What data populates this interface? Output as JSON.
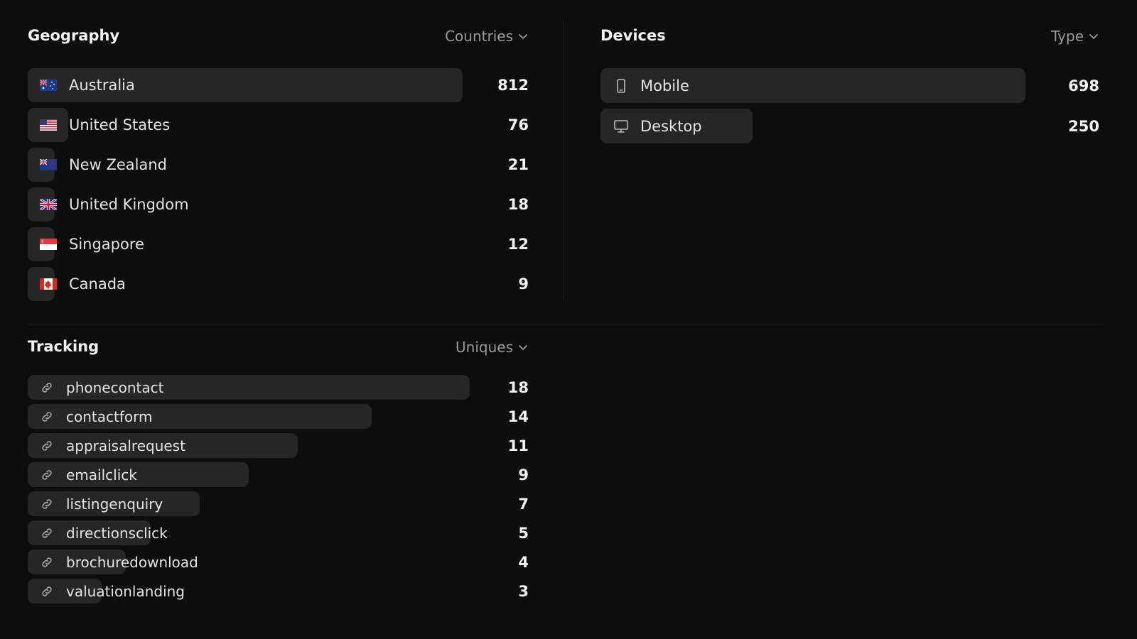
{
  "geography": {
    "title": "Geography",
    "dropdown_label": "Countries",
    "max_value": 812,
    "rows": [
      {
        "label": "Australia",
        "value": "812",
        "n": 812,
        "flag": "au"
      },
      {
        "label": "United States",
        "value": "76",
        "n": 76,
        "flag": "us"
      },
      {
        "label": "New Zealand",
        "value": "21",
        "n": 21,
        "flag": "nz"
      },
      {
        "label": "United Kingdom",
        "value": "18",
        "n": 18,
        "flag": "gb"
      },
      {
        "label": "Singapore",
        "value": "12",
        "n": 12,
        "flag": "sg"
      },
      {
        "label": "Canada",
        "value": "9",
        "n": 9,
        "flag": "ca"
      }
    ]
  },
  "devices": {
    "title": "Devices",
    "dropdown_label": "Type",
    "max_value": 698,
    "rows": [
      {
        "label": "Mobile",
        "value": "698",
        "n": 698,
        "icon": "mobile-icon"
      },
      {
        "label": "Desktop",
        "value": "250",
        "n": 250,
        "icon": "desktop-icon"
      }
    ]
  },
  "tracking": {
    "title": "Tracking",
    "dropdown_label": "Uniques",
    "max_value": 18,
    "icon": "link-icon",
    "rows": [
      {
        "label": "phonecontact",
        "value": "18",
        "n": 18
      },
      {
        "label": "contactform",
        "value": "14",
        "n": 14
      },
      {
        "label": "appraisalrequest",
        "value": "11",
        "n": 11
      },
      {
        "label": "emailclick",
        "value": "9",
        "n": 9
      },
      {
        "label": "listingenquiry",
        "value": "7",
        "n": 7
      },
      {
        "label": "directionsclick",
        "value": "5",
        "n": 5
      },
      {
        "label": "brochuredownload",
        "value": "4",
        "n": 4
      },
      {
        "label": "valuationlanding",
        "value": "3",
        "n": 3
      }
    ]
  },
  "colors": {
    "background": "#0d0d0d",
    "bar": "#262626",
    "text": "#e6e6e6",
    "muted": "#9a9a9a"
  }
}
